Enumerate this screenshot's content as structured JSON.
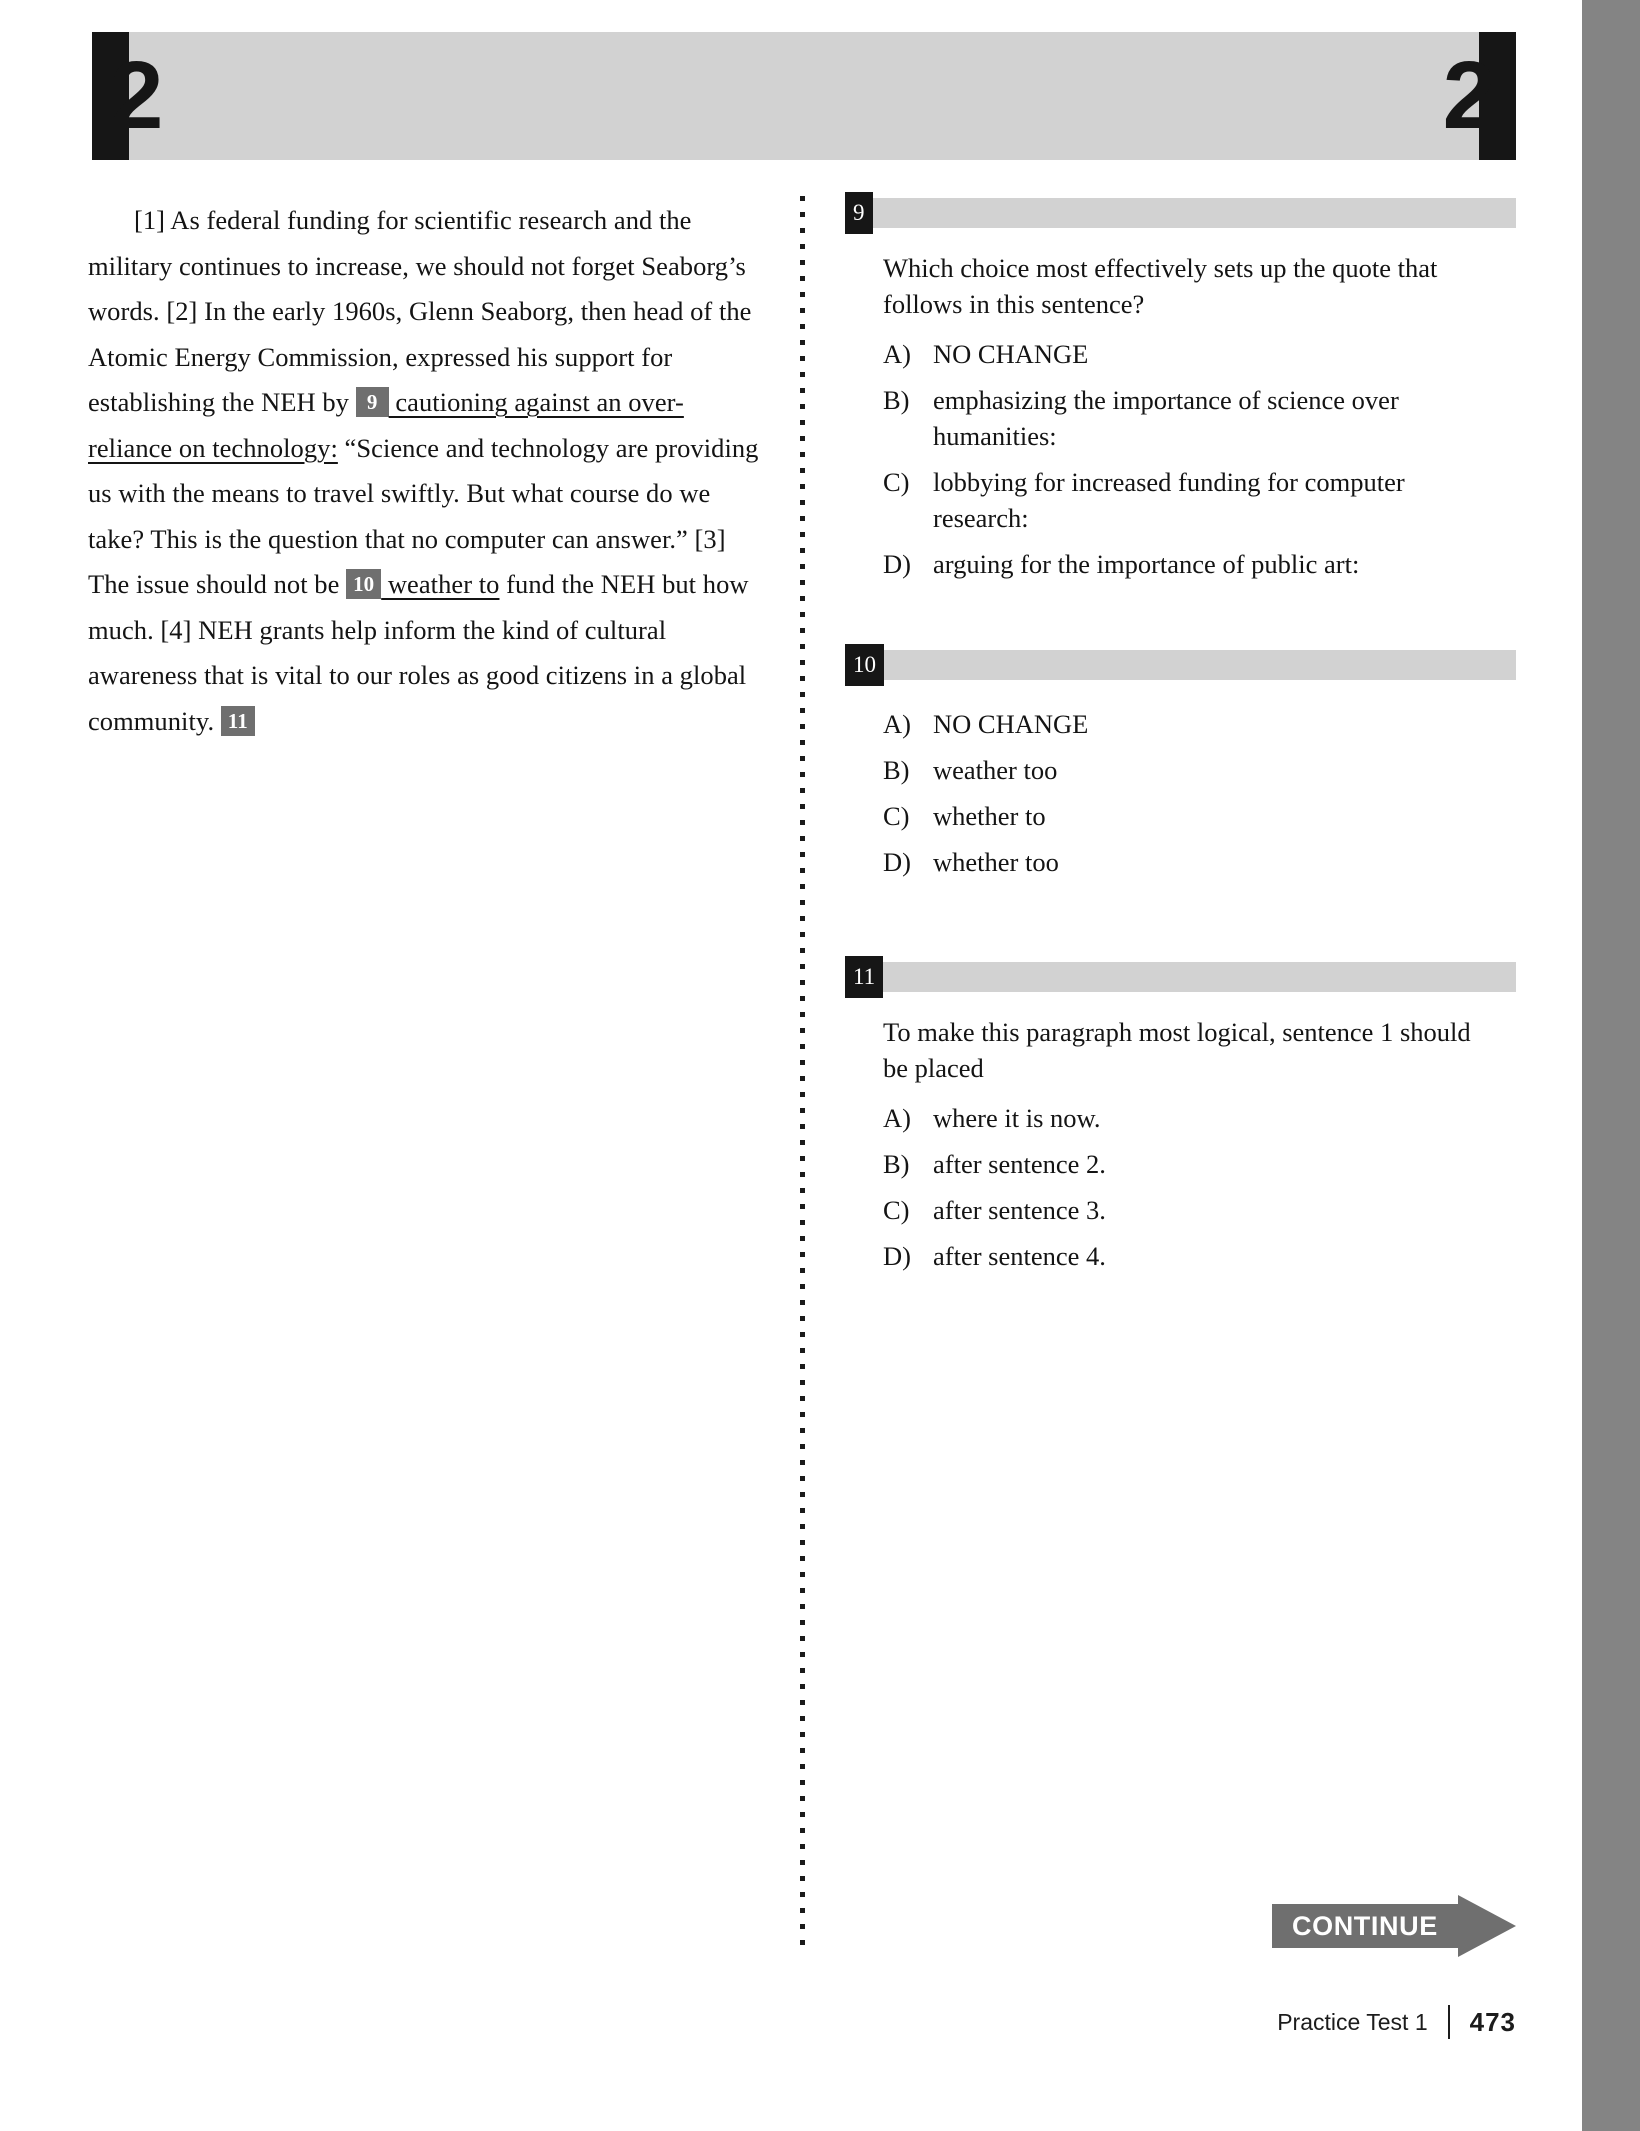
{
  "section_header": {
    "left_number": "2",
    "right_number": "2"
  },
  "passage": {
    "segments": [
      {
        "type": "text",
        "value": "[1] As federal funding for scientific research and the military continues to increase, we should not forget Seaborg’s words. [2] In the early 1960s, Glenn Seaborg, then head of the Atomic Energy Commission, expressed his support for establishing the NEH by "
      },
      {
        "type": "marker",
        "value": "9"
      },
      {
        "type": "underlined",
        "value": " cautioning against an over-reliance on technology:"
      },
      {
        "type": "text",
        "value": " “Science and technology are providing us with the means to travel swiftly. But what course do we take? This is the question that no computer can answer.” [3] The issue should not be "
      },
      {
        "type": "marker",
        "value": "10"
      },
      {
        "type": "underlined",
        "value": " weather to"
      },
      {
        "type": "text",
        "value": " fund the NEH but how much. [4] NEH grants help inform the kind of cultural awareness that is vital to our roles as good citizens in a global community. "
      },
      {
        "type": "marker",
        "value": "11"
      }
    ]
  },
  "questions": [
    {
      "number": "9",
      "stem": "Which choice most effectively sets up the quote that follows in this sentence?",
      "choices": [
        {
          "letter": "A)",
          "text": "NO CHANGE"
        },
        {
          "letter": "B)",
          "text": "emphasizing the importance of science over humanities:"
        },
        {
          "letter": "C)",
          "text": "lobbying for increased funding for computer research:"
        },
        {
          "letter": "D)",
          "text": "arguing for the importance of public art:"
        }
      ]
    },
    {
      "number": "10",
      "stem": "",
      "choices": [
        {
          "letter": "A)",
          "text": "NO CHANGE"
        },
        {
          "letter": "B)",
          "text": "weather too"
        },
        {
          "letter": "C)",
          "text": "whether to"
        },
        {
          "letter": "D)",
          "text": "whether too"
        }
      ]
    },
    {
      "number": "11",
      "stem": "To make this paragraph most logical, sentence 1 should be placed",
      "choices": [
        {
          "letter": "A)",
          "text": "where it is now."
        },
        {
          "letter": "B)",
          "text": "after sentence 2."
        },
        {
          "letter": "C)",
          "text": "after sentence 3."
        },
        {
          "letter": "D)",
          "text": "after sentence 4."
        }
      ]
    }
  ],
  "continue_banner": {
    "label": "CONTINUE"
  },
  "footer": {
    "test_label": "Practice Test 1",
    "page_number": "473"
  },
  "colors": {
    "header_black": "#161616",
    "header_gray": "#d2d2d2",
    "marker_gray": "#6f6f6f",
    "edge_band_gray": "#848484",
    "continue_gray": "#6f6f6f"
  }
}
